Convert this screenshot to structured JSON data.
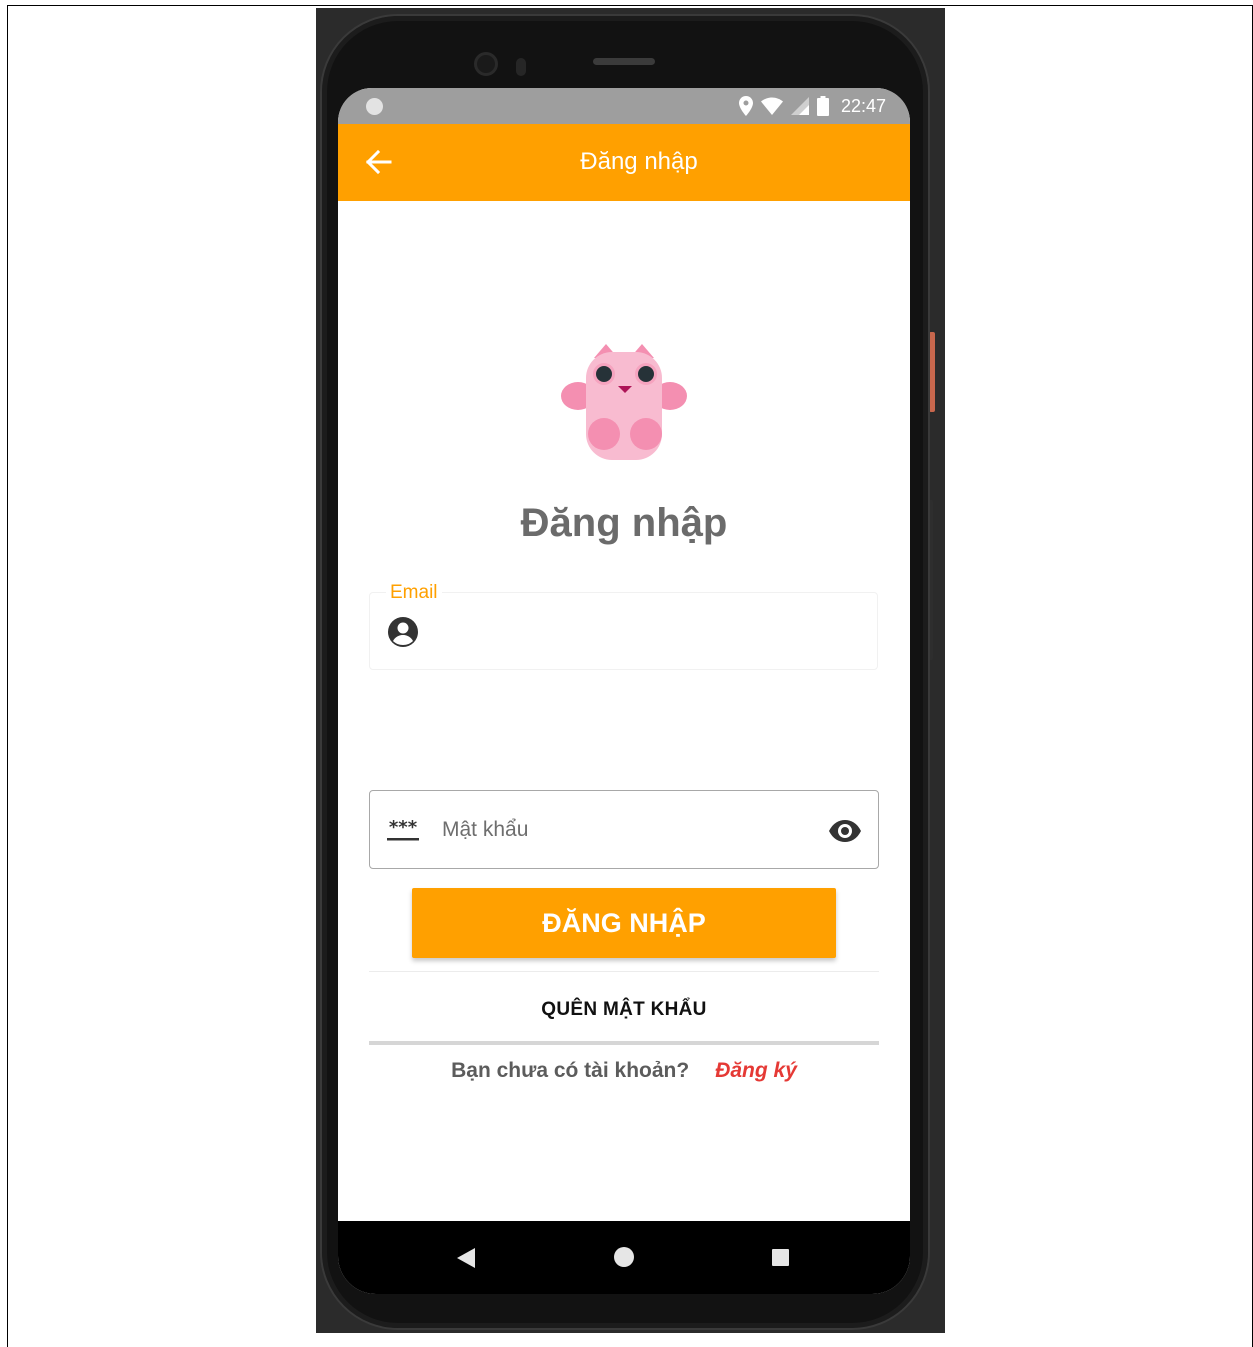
{
  "status_bar": {
    "time": "22:47",
    "icons": [
      "location-icon",
      "wifi-icon",
      "signal-icon",
      "battery-icon"
    ]
  },
  "app_bar": {
    "title": "Đăng nhập",
    "back_icon": "arrow-left-icon"
  },
  "mascot": {
    "icon": "pink-cat-mascot"
  },
  "login_form": {
    "heading": "Đăng nhập",
    "email": {
      "label": "Email",
      "value": "",
      "icon": "account-circle-icon"
    },
    "password": {
      "placeholder": "Mật khẩu",
      "value": "",
      "prefix_icon": "password-dots-icon",
      "suffix_icon": "eye-icon"
    },
    "submit_label": "ĐĂNG NHẬP",
    "forgot_label": "QUÊN MẬT KHẨU",
    "register_question": "Bạn chưa có tài khoản?",
    "register_link": "Đăng ký"
  },
  "nav_bar": {
    "icons": [
      "nav-back-icon",
      "nav-home-icon",
      "nav-recents-icon"
    ]
  },
  "colors": {
    "accent": "#ffa000",
    "link": "#e53935",
    "heading": "#6b6b6b",
    "status_bar": "#9e9e9e"
  }
}
